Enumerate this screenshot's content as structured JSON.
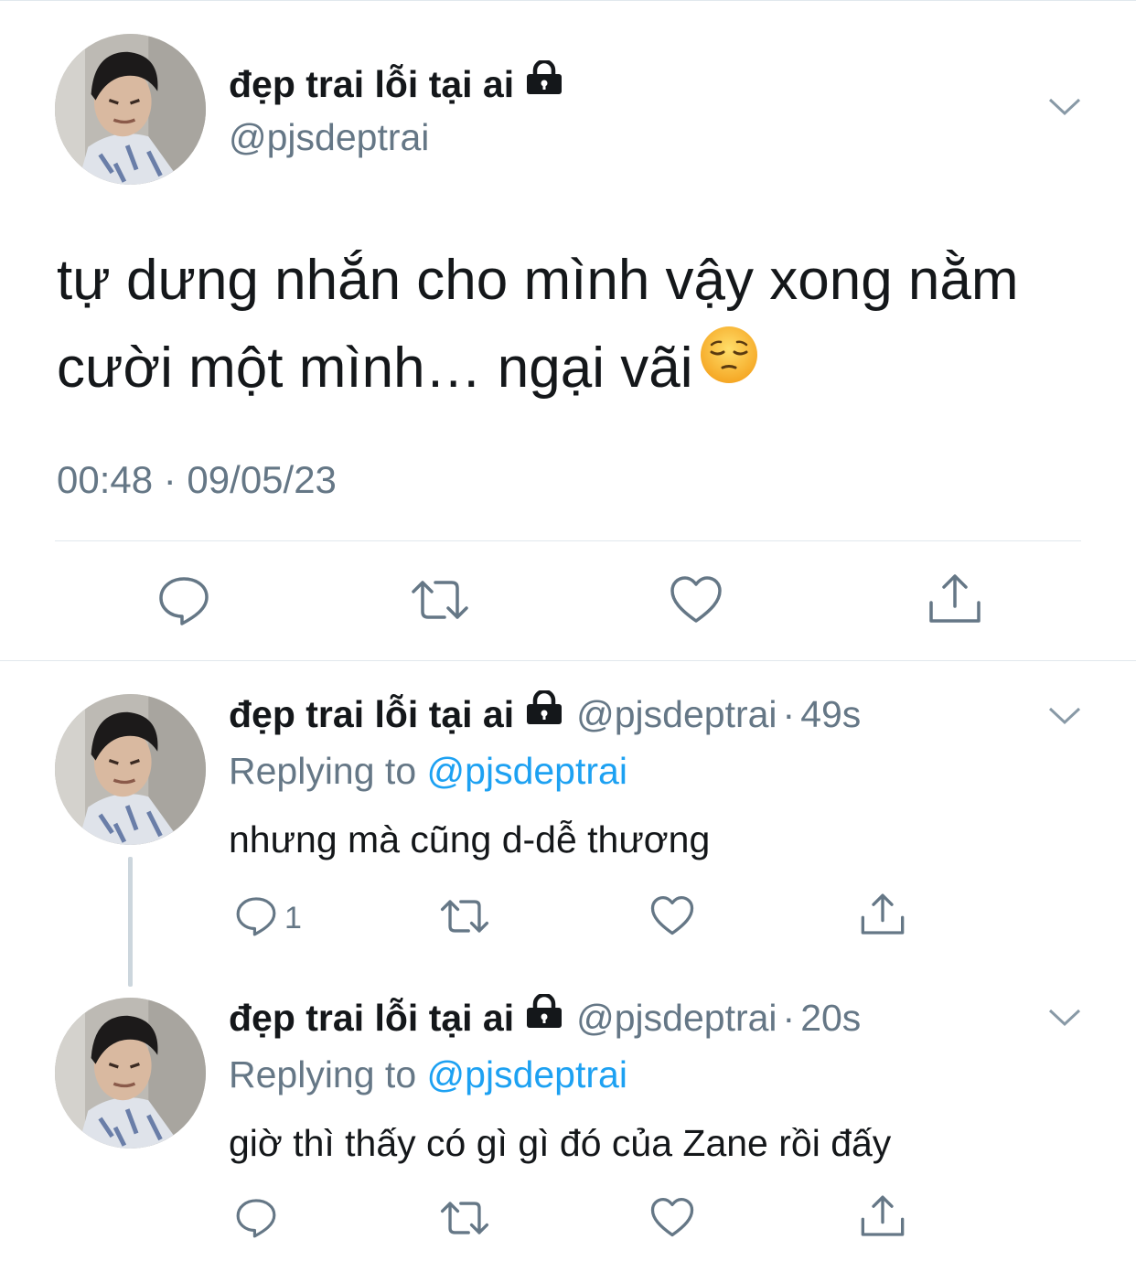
{
  "colors": {
    "text": "#14171a",
    "secondary": "#657786",
    "link": "#1da1f2",
    "divider": "#e1e8ed",
    "thread_line": "#ccd6dd"
  },
  "main_tweet": {
    "display_name": "đẹp trai lỗi tại ai",
    "handle": "@pjsdeptrai",
    "text_line1": "tự dưng nhắn cho mình vậy xong nằm",
    "text_line2": "cười một mình… ngại vãi",
    "emoji": "pensive-face-emoji",
    "timestamp": "00:48 · 09/05/23",
    "actions": [
      "reply-icon",
      "retweet-icon",
      "like-icon",
      "share-icon"
    ]
  },
  "replies": [
    {
      "display_name": "đẹp trai lỗi tại ai",
      "handle": "@pjsdeptrai",
      "separator": "·",
      "time": "49s",
      "replying_prefix": "Replying to",
      "replying_to": "@pjsdeptrai",
      "text": "nhưng mà cũng d-dễ thương",
      "reply_count": "1"
    },
    {
      "display_name": "đẹp trai lỗi tại ai",
      "handle": "@pjsdeptrai",
      "separator": "·",
      "time": "20s",
      "replying_prefix": "Replying to",
      "replying_to": "@pjsdeptrai",
      "text": "giờ thì thấy có gì gì đó của Zane rồi đấy",
      "reply_count": ""
    }
  ]
}
